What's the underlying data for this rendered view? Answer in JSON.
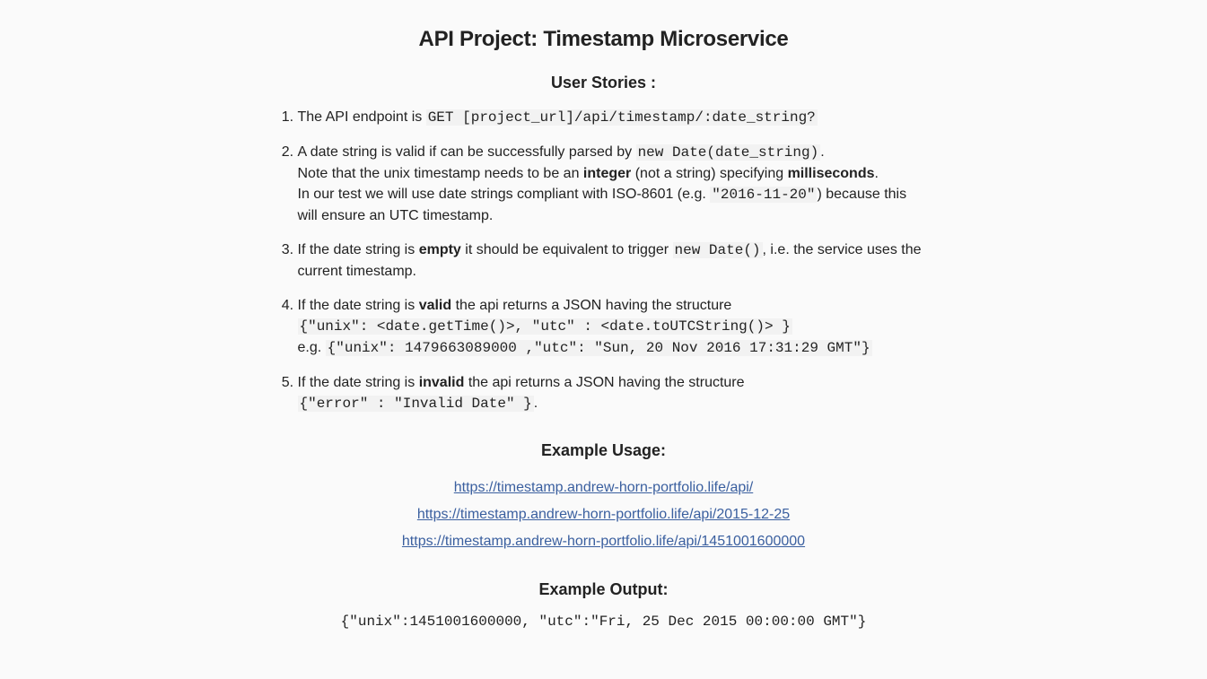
{
  "title": "API Project: Timestamp Microservice",
  "stories_heading": "User Stories :",
  "stories": {
    "s1": {
      "text1": "The API endpoint is ",
      "code1": "GET [project_url]/api/timestamp/:date_string?"
    },
    "s2": {
      "text1": "A date string is valid if can be successfully parsed by ",
      "code1": "new Date(date_string)",
      "text2": ".",
      "text3": "Note that the unix timestamp needs to be an ",
      "bold1": "integer",
      "text4": " (not a string) specifying ",
      "bold2": "milliseconds",
      "text5": ".",
      "text6": "In our test we will use date strings compliant with ISO-8601 (e.g. ",
      "code2": "\"2016-11-20\"",
      "text7": ") because this will ensure an UTC timestamp."
    },
    "s3": {
      "text1": "If the date string is ",
      "bold1": "empty",
      "text2": " it should be equivalent to trigger ",
      "code1": "new Date()",
      "text3": ", i.e. the service uses the current timestamp."
    },
    "s4": {
      "text1": "If the date string is ",
      "bold1": "valid",
      "text2": " the api returns a JSON having the structure",
      "code1": "{\"unix\": <date.getTime()>, \"utc\" : <date.toUTCString()> }",
      "text3": "e.g. ",
      "code2": "{\"unix\": 1479663089000 ,\"utc\": \"Sun, 20 Nov 2016 17:31:29 GMT\"}"
    },
    "s5": {
      "text1": "If the date string is ",
      "bold1": "invalid",
      "text2": " the api returns a JSON having the structure",
      "code1": "{\"error\" : \"Invalid Date\" }",
      "text3": "."
    }
  },
  "usage_heading": "Example Usage:",
  "links": [
    "https://timestamp.andrew-horn-portfolio.life/api/",
    "https://timestamp.andrew-horn-portfolio.life/api/2015-12-25",
    "https://timestamp.andrew-horn-portfolio.life/api/1451001600000"
  ],
  "output_heading": "Example Output:",
  "output": "{\"unix\":1451001600000, \"utc\":\"Fri, 25 Dec 2015 00:00:00 GMT\"}",
  "colors": {
    "link": "#3a5f9f",
    "background": "#fafafa"
  }
}
